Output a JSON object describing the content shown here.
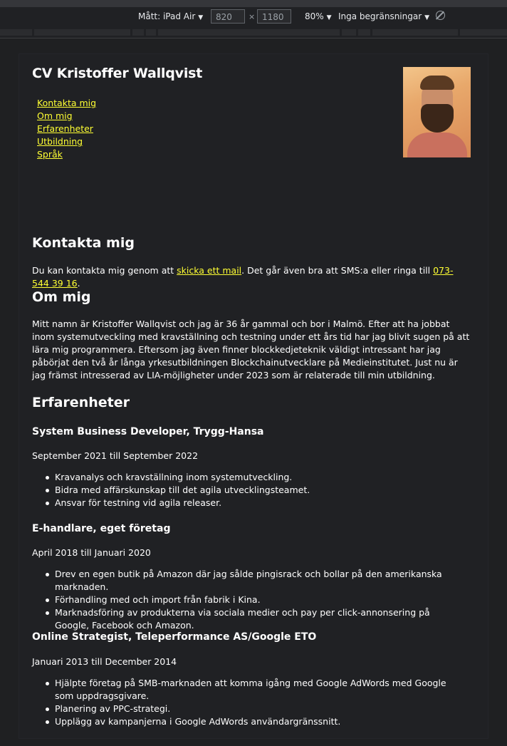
{
  "devtools": {
    "device_label": "Mått: iPad Air",
    "width": "820",
    "times": "×",
    "height": "1180",
    "zoom": "80%",
    "throttle": "Inga begränsningar"
  },
  "header": {
    "title": "CV Kristoffer Wallqvist",
    "nav": [
      "Kontakta mig",
      "Om mig",
      "Erfarenheter",
      "Utbildning",
      "Språk"
    ]
  },
  "contact": {
    "heading": "Kontakta mig",
    "text_before": "Du kan kontakta mig genom att ",
    "mail_link": "skicka ett mail",
    "text_middle": ". Det går även bra att SMS:a eller ringa till ",
    "phone_link": "073-544 39 16",
    "text_after": "."
  },
  "about": {
    "heading": "Om mig",
    "text": "Mitt namn är Kristoffer Wallqvist och jag är 36 år gammal och bor i Malmö. Efter att ha jobbat inom systemutveckling med kravställning och testning under ett års tid har jag blivit sugen på att lära mig programmera. Eftersom jag även finner blockkedjeteknik väldigt intressant har jag påbörjat den två år långa yrkesutbildningen Blockchainutvecklare på Medieinstitutet. Just nu är jag främst intresserad av LIA-möjligheter under 2023 som är relaterade till min utbildning."
  },
  "experience": {
    "heading": "Erfarenheter",
    "jobs": [
      {
        "title": "System Business Developer, Trygg-Hansa",
        "period": "September 2021 till September 2022",
        "items": [
          "Kravanalys och kravställning inom systemutveckling.",
          "Bidra med affärskunskap till det agila utvecklingsteamet.",
          "Ansvar för testning vid agila releaser."
        ]
      },
      {
        "title": "E-handlare, eget företag",
        "period": "April 2018 till Januari 2020",
        "items": [
          "Drev en egen butik på Amazon där jag sålde pingisrack och bollar på den amerikanska marknaden.",
          "Förhandling med och import från fabrik i Kina.",
          "Marknadsföring av produkterna via sociala medier och pay per click-annonsering på Google, Facebook och Amazon."
        ]
      },
      {
        "title": "Online Strategist, Teleperformance AS/Google ETO",
        "period": "Januari 2013 till December 2014",
        "items": [
          "Hjälpte företag på SMB-marknaden att komma igång med Google AdWords med Google som uppdragsgivare.",
          "Planering av PPC-strategi.",
          "Upplägg av kampanjerna i Google AdWords användargränssnitt."
        ]
      }
    ]
  },
  "colors": {
    "link": "#ffff33",
    "background": "#202124",
    "text": "#ffffff"
  }
}
